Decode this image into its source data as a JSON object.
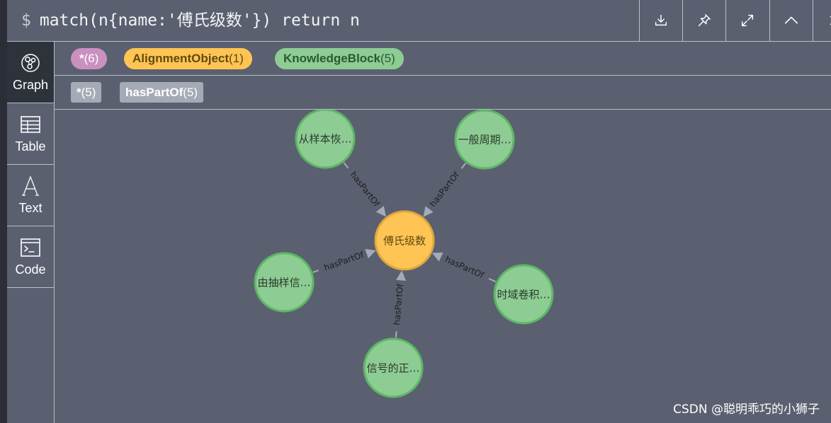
{
  "header": {
    "prompt": "$",
    "query": "match(n{name:'傅氏级数'}) return n",
    "buttons": [
      "download-icon",
      "pin-icon",
      "expand-icon",
      "collapse-up-icon",
      "close-icon"
    ]
  },
  "sidebar": {
    "tabs": [
      {
        "label": "Graph",
        "icon": "graph-icon",
        "active": true
      },
      {
        "label": "Table",
        "icon": "table-icon",
        "active": false
      },
      {
        "label": "Text",
        "icon": "text-icon",
        "active": false
      },
      {
        "label": "Code",
        "icon": "code-icon",
        "active": false
      }
    ]
  },
  "legend": {
    "node_labels": [
      {
        "name": "*",
        "count": "(6)",
        "color": "#c990c0",
        "text_color": "#ffffff"
      },
      {
        "name": "AlignmentObject",
        "count": "(1)",
        "color": "#ffc454",
        "text_color": "#604a0e"
      },
      {
        "name": "KnowledgeBlock",
        "count": "(5)",
        "color": "#8dcc93",
        "text_color": "#2a5a2e"
      }
    ],
    "relationship_types": [
      {
        "name": "*",
        "count": "(5)"
      },
      {
        "name": "hasPartOf",
        "count": "(5)"
      }
    ]
  },
  "graph": {
    "center_node": {
      "label": "傅氏级数",
      "fill": "#ffc454",
      "stroke": "#e0a83c",
      "text_color": "#604a0e"
    },
    "outer_nodes": [
      {
        "label": "从样本恢…",
        "fill": "#8dcc93",
        "stroke": "#5db665"
      },
      {
        "label": "一般周期…",
        "fill": "#8dcc93",
        "stroke": "#5db665"
      },
      {
        "label": "由抽样信…",
        "fill": "#8dcc93",
        "stroke": "#5db665"
      },
      {
        "label": "时域卷积…",
        "fill": "#8dcc93",
        "stroke": "#5db665"
      },
      {
        "label": "信号的正…",
        "fill": "#8dcc93",
        "stroke": "#5db665"
      }
    ],
    "relationship_label": "hasPartOf",
    "edge_color": "#a5abb6",
    "edge_text_color": "#1e1e1e"
  },
  "watermark": "CSDN @聪明乖巧的小狮子"
}
